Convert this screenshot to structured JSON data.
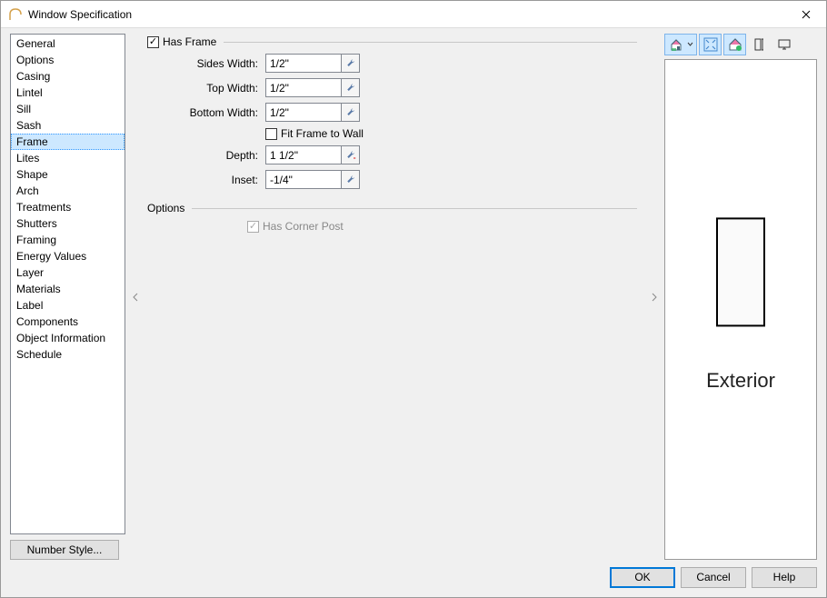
{
  "window": {
    "title": "Window Specification"
  },
  "nav": {
    "items": [
      "General",
      "Options",
      "Casing",
      "Lintel",
      "Sill",
      "Sash",
      "Frame",
      "Lites",
      "Shape",
      "Arch",
      "Treatments",
      "Shutters",
      "Framing",
      "Energy Values",
      "Layer",
      "Materials",
      "Label",
      "Components",
      "Object Information",
      "Schedule"
    ],
    "selected": "Frame"
  },
  "number_style_label": "Number Style...",
  "form": {
    "has_frame": {
      "label": "Has Frame",
      "checked": true
    },
    "sides_width": {
      "label": "Sides Width:",
      "value": "1/2\""
    },
    "top_width": {
      "label": "Top Width:",
      "value": "1/2\""
    },
    "bottom_width": {
      "label": "Bottom Width:",
      "value": "1/2\""
    },
    "fit_frame": {
      "label": "Fit Frame to Wall",
      "checked": false
    },
    "depth": {
      "label": "Depth:",
      "value": "1 1/2\""
    },
    "inset": {
      "label": "Inset:",
      "value": "-1/4\""
    }
  },
  "options_group": {
    "label": "Options",
    "has_corner_post": {
      "label": "Has Corner Post",
      "checked": true,
      "disabled": true
    }
  },
  "preview": {
    "label": "Exterior"
  },
  "buttons": {
    "ok": "OK",
    "cancel": "Cancel",
    "help": "Help"
  }
}
